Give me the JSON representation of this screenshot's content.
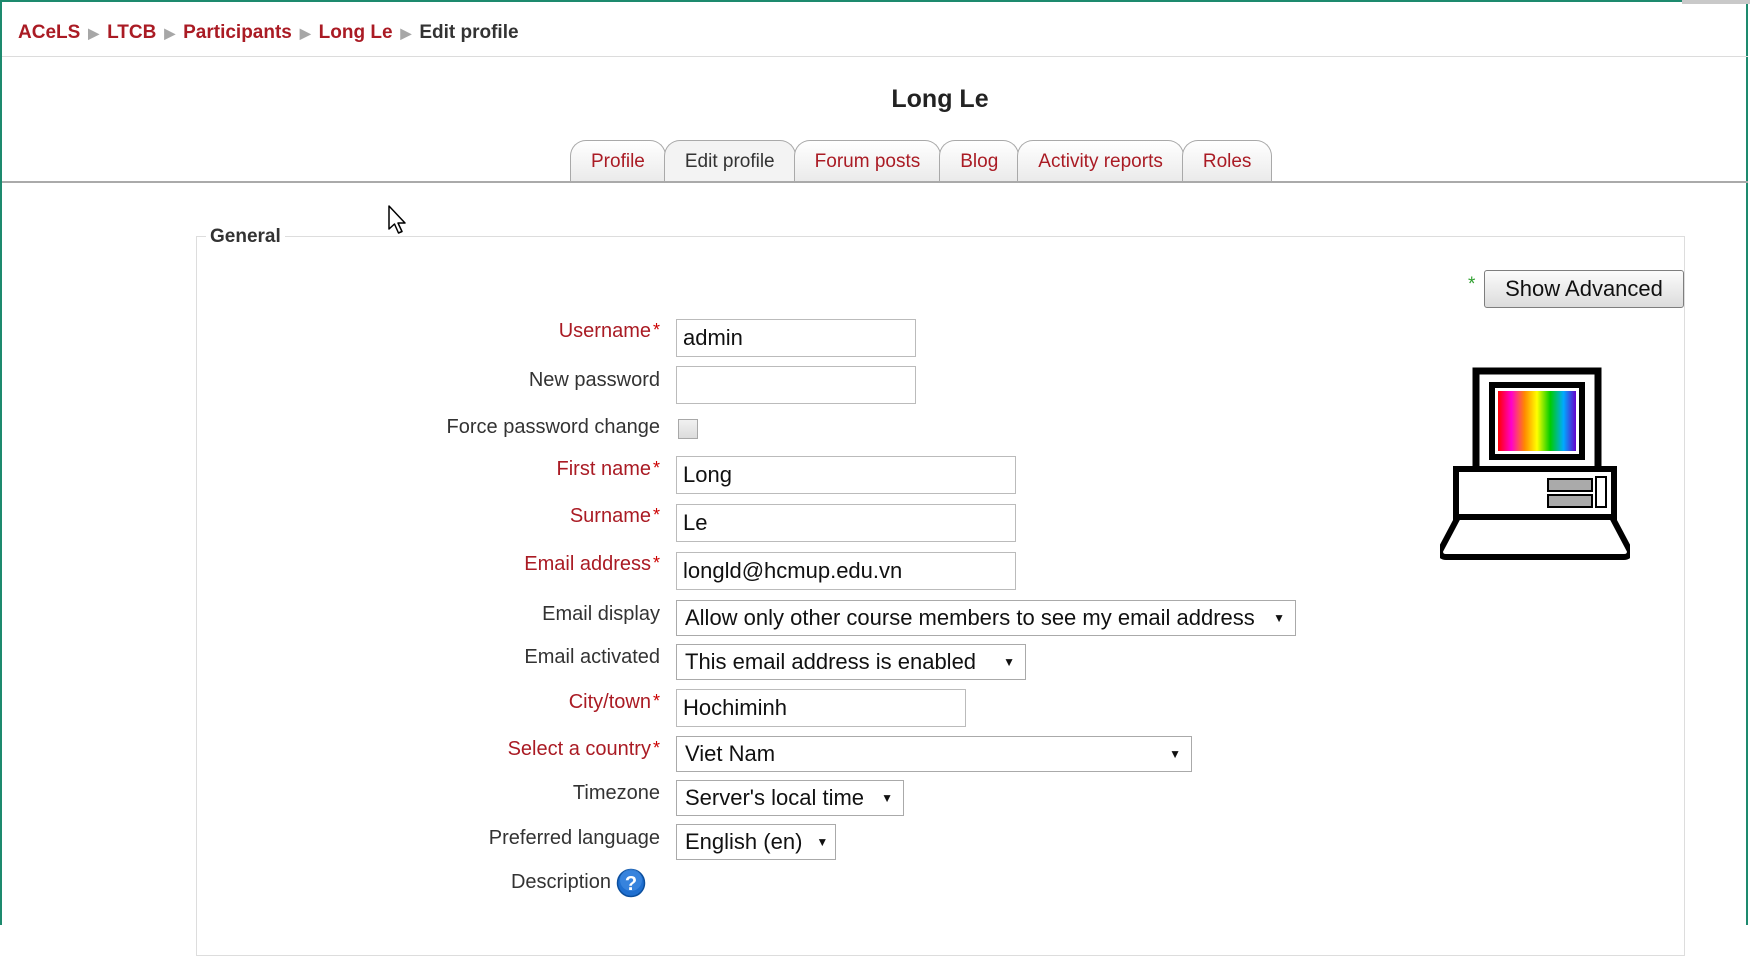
{
  "breadcrumb": {
    "items": [
      "ACeLS",
      "LTCB",
      "Participants",
      "Long Le"
    ],
    "current": "Edit profile"
  },
  "page": {
    "title": "Long Le"
  },
  "tabs": [
    {
      "label": "Profile",
      "active": false
    },
    {
      "label": "Edit profile",
      "active": true
    },
    {
      "label": "Forum posts",
      "active": false
    },
    {
      "label": "Blog",
      "active": false
    },
    {
      "label": "Activity reports",
      "active": false
    },
    {
      "label": "Roles",
      "active": false
    }
  ],
  "form": {
    "section_title": "General",
    "show_advanced_label": "Show Advanced",
    "show_advanced_star": "*",
    "required_marker": "*",
    "fields": {
      "username": {
        "label": "Username",
        "value": "admin"
      },
      "new_password": {
        "label": "New password",
        "value": ""
      },
      "force_password_change": {
        "label": "Force password change",
        "checked": false
      },
      "first_name": {
        "label": "First name",
        "value": "Long"
      },
      "surname": {
        "label": "Surname",
        "value": "Le"
      },
      "email": {
        "label": "Email address",
        "value": "longld@hcmup.edu.vn"
      },
      "email_display": {
        "label": "Email display",
        "value": "Allow only other course members to see my email address"
      },
      "email_activated": {
        "label": "Email activated",
        "value": "This email address is enabled"
      },
      "city": {
        "label": "City/town",
        "value": "Hochiminh"
      },
      "country": {
        "label": "Select a country",
        "value": "Viet Nam"
      },
      "timezone": {
        "label": "Timezone",
        "value": "Server's local time"
      },
      "language": {
        "label": "Preferred language",
        "value": "English (en)"
      },
      "description": {
        "label": "Description"
      }
    }
  },
  "icons": {
    "breadcrumb_separator": "arrow-right-icon",
    "select_caret": "caret-down-icon",
    "help": "help-question-icon",
    "avatar": "computer-avatar-icon",
    "cursor": "mouse-pointer-icon"
  },
  "colors": {
    "link": "#aa1b24",
    "required_star": "#cc0000",
    "advanced_star": "#30a030",
    "frame_border": "#1d8a6e"
  }
}
